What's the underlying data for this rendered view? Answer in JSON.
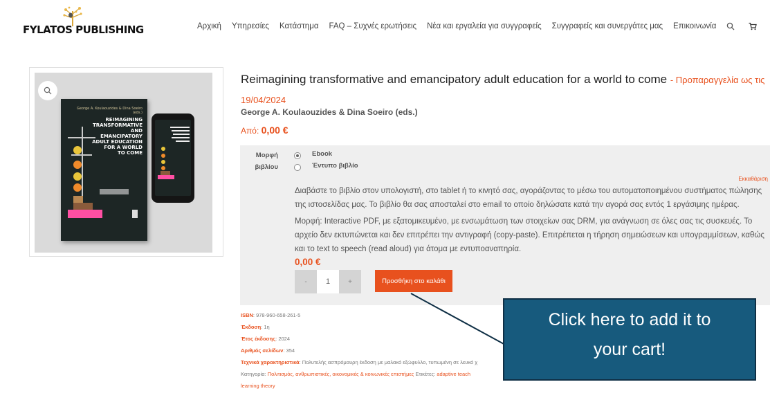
{
  "brand": {
    "left": "FYLATOS",
    "right": "PUBLISHING"
  },
  "nav": {
    "items": [
      "Αρχική",
      "Υπηρεσίες",
      "Κατάστημα",
      "FAQ – Συχνές ερωτήσεις",
      "Νέα και εργαλεία για συγγραφείς",
      "Συγγραφείς και συνεργάτες μας",
      "Επικοινωνία"
    ],
    "search_icon": "search-icon",
    "cart_icon": "cart-icon"
  },
  "product": {
    "title": "Reimagining transformative and emancipatory adult education for a world to come",
    "preorder": "- Προπαραγγελία ως τις 19/04/2024",
    "authors": "George A. Koulaouzides & Dina Soeiro (eds.)",
    "from_label": "Από:",
    "from_price": "0,00 €",
    "cover": {
      "authors": "George A. Koulaouzides & Dina Soeiro (eds.)",
      "title_lines": [
        "REIMAGINING",
        "TRANSFORMATIVE",
        "AND EMANCIPATORY",
        "ADULT EDUCATION",
        "FOR A WORLD",
        "TO COME"
      ]
    }
  },
  "format": {
    "label_line1": "Μορφή",
    "label_line2": "βιβλίου",
    "options": [
      {
        "label": "Ebook",
        "selected": true
      },
      {
        "label": "Έντυπο βιβλίο",
        "selected": false
      }
    ],
    "clear": "Εκκαθάριση"
  },
  "description": {
    "p1": "Διαβάστε το βιβλίο στον υπολογιστή, στο tablet ή το κινητό σας, αγοράζοντας το μέσω του αυτοματοποιημένου συστήματος πώλησης της ιστοσελίδας μας. Το βιβλίο θα σας αποσταλεί στο email το οποίο δηλώσατε κατά την αγορά σας εντός 1 εργάσιμης ημέρας.",
    "p2": "Μορφή: Interactive PDF, με εξατομικευμένο, με ενσωμάτωση των στοιχείων σας DRM, για ανάγνωση σε όλες σας τις συσκευές. Το αρχείο δεν εκτυπώνεται και δεν επιτρέπει την αντιγραφή (copy-paste). Επιτρέπεται η τήρηση σημειώσεων και υπογραμμίσεων, καθώς και το text to speech (read aloud) για άτομα με εντυποαναπηρία."
  },
  "cart": {
    "price": "0,00 €",
    "minus": "-",
    "qty": "1",
    "plus": "+",
    "add_button": "Προσθήκη στο καλάθι"
  },
  "meta": {
    "isbn_k": "ISBN",
    "isbn_v": ": 978-960-658-261-5",
    "edition_k": "Έκδοση",
    "edition_v": ": 1η",
    "year_k": "Έτος έκδοσης",
    "year_v": ": 2024",
    "pages_k": "Αριθμός σελίδων",
    "pages_v": ": 354",
    "tech_k": "Τεχνικά χαρακτηριστικά",
    "tech_v": ": Πολυτελής ασπρόμαυρη έκδοση με μαλακό εξώφυλλο, τυπωμένη σε λευκό χ",
    "cat_label": "Κατηγορία: ",
    "cat_link": "Πολιτισμός, ανθρωπιστικές, οικονομικές & κοινωνικές επιστήμες",
    "tags_label": " Ετικέτες: ",
    "tags_link": "adaptive teach",
    "tags_cont": "learning theory"
  },
  "callout": {
    "line1": "Click here to add it to",
    "line2": "your cart!"
  },
  "colors": {
    "accent": "#e8511e",
    "callout": "#175a7d"
  }
}
